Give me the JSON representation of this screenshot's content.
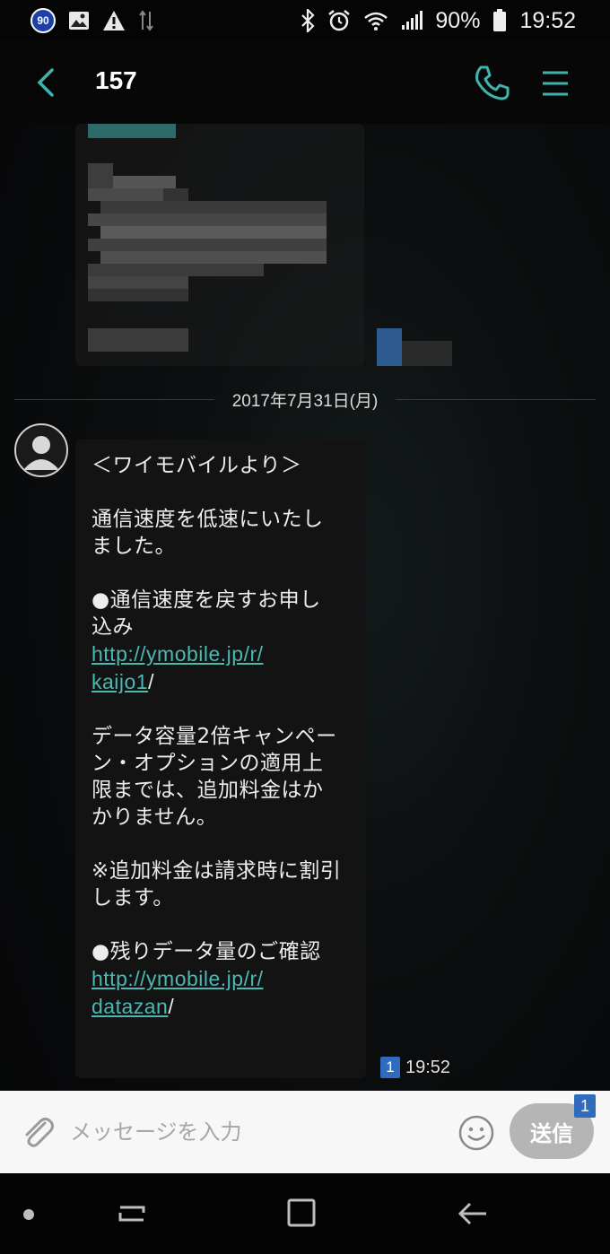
{
  "status_bar": {
    "notification_badge": "90",
    "battery_percent": "90%",
    "time": "19:52"
  },
  "app_bar": {
    "contact_name": "157"
  },
  "date_separator": "2017年7月31日(月)",
  "message": {
    "lines": {
      "l1": "＜ワイモバイルより＞",
      "l2": "通信速度を低速にいたし",
      "l3": "ました。",
      "l4": "●通信速度を戻すお申し",
      "l5": "込み",
      "link1_part1": "http://ymobile.jp/r/",
      "link1_part2": "kaijo1",
      "slash": "/",
      "l8": "データ容量2倍キャンペー",
      "l9": "ン・オプションの適用上",
      "l10": "限までは、追加料金はか",
      "l11": "かりません。",
      "l12": "※追加料金は請求時に割引",
      "l13": "します。",
      "l14": "●残りデータ量のご確認",
      "link2_part1": "http://ymobile.jp/r/",
      "link2_part2": "datazan"
    },
    "unread_count": "1",
    "time": "19:52"
  },
  "composer": {
    "placeholder": "メッセージを入力",
    "send_label": "送信",
    "send_count": "1"
  },
  "colors": {
    "accent": "#4bb8b2",
    "badge_blue": "#2f6cbf"
  },
  "icons": [
    "back-arrow-icon",
    "phone-icon",
    "menu-icon",
    "paperclip-icon",
    "smiley-icon",
    "recent-apps-icon",
    "home-icon",
    "nav-back-icon"
  ]
}
